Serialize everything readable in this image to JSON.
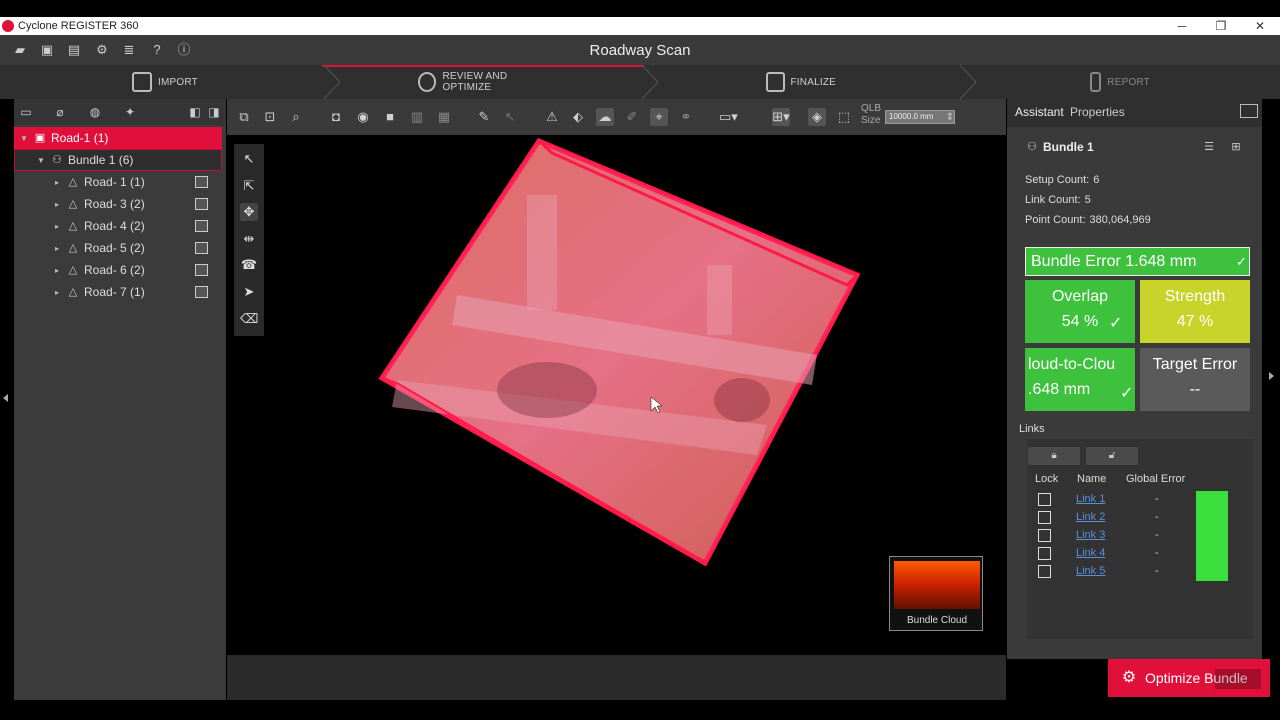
{
  "app": {
    "title": "Cyclone REGISTER 360"
  },
  "window_controls": {
    "minimize": "─",
    "restore": "❐",
    "close": "✕"
  },
  "header": {
    "project_title": "Roadway Scan",
    "icons": [
      "open-folder-icon",
      "save-icon",
      "panels-icon",
      "gear-icon",
      "database-icon",
      "help-icon",
      "info-icon"
    ]
  },
  "workflow": {
    "steps": [
      {
        "label": "IMPORT",
        "icon": "import-icon",
        "active": false
      },
      {
        "label": "REVIEW AND OPTIMIZE",
        "icon": "review-icon",
        "active": true
      },
      {
        "label": "FINALIZE",
        "icon": "finalize-icon",
        "active": false
      },
      {
        "label": "REPORT",
        "icon": "report-icon",
        "active": false
      }
    ]
  },
  "tree": {
    "root": {
      "label": "Road-1 (1)"
    },
    "bundle": {
      "label": "Bundle 1 (6)"
    },
    "setups": [
      {
        "label": "Road- 1 (1)"
      },
      {
        "label": "Road- 3 (2)"
      },
      {
        "label": "Road- 4 (2)"
      },
      {
        "label": "Road- 5 (2)"
      },
      {
        "label": "Road- 6 (2)"
      },
      {
        "label": "Road- 7 (1)"
      }
    ]
  },
  "toolbar": {
    "qlb_label_1": "QLB",
    "qlb_label_2": "Size",
    "qlb_value": "10000.0 mm"
  },
  "viewport": {
    "thumbnail_label": "Bundle Cloud"
  },
  "right_panel": {
    "tabs": [
      "Assistant",
      "Properties"
    ],
    "bundle_title": "Bundle 1",
    "setup_count_label": "Setup Count:",
    "setup_count": "6",
    "link_count_label": "Link Count:",
    "link_count": "5",
    "point_count_label": "Point Count:",
    "point_count": "380,064,969",
    "bundle_error": "Bundle Error 1.648 mm",
    "overlap_title": "Overlap",
    "overlap_value": "54 %",
    "strength_title": "Strength",
    "strength_value": "47 %",
    "c2c_title": "loud-to-Clou",
    "c2c_value": ".648 mm",
    "target_error_title": "Target Error",
    "target_error_value": "--",
    "check": "✓",
    "colors": {
      "green": "#3ec23e",
      "yellow": "#c8d42a",
      "gray": "#5a5a5a",
      "accent": "#e0103a"
    }
  },
  "links": {
    "label": "Links",
    "columns": [
      "Lock",
      "Name",
      "Global Error"
    ],
    "rows": [
      {
        "name": "Link 1",
        "error": "-"
      },
      {
        "name": "Link 2",
        "error": "-"
      },
      {
        "name": "Link 3",
        "error": "-"
      },
      {
        "name": "Link 4",
        "error": "-"
      },
      {
        "name": "Link 5",
        "error": "-"
      }
    ]
  },
  "actions": {
    "optimize_label": "Optimize Bundle"
  }
}
